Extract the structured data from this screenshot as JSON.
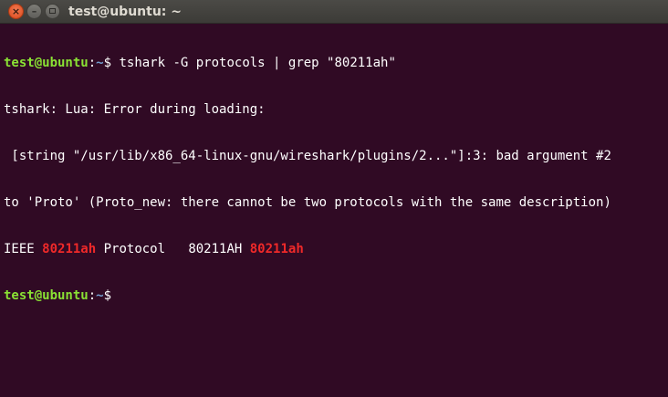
{
  "window": {
    "title": "test@ubuntu: ~",
    "buttons": {
      "close_glyph": "×",
      "minimize_glyph": "–"
    }
  },
  "terminal": {
    "colors": {
      "background": "#300a24",
      "foreground": "#ffffff",
      "prompt_user": "#8ae234",
      "prompt_path": "#729fcf",
      "match": "#ef2929"
    },
    "prompt": {
      "user_host": "test@ubuntu",
      "colon": ":",
      "path": "~",
      "dollar": "$"
    },
    "command": " tshark -G protocols | grep \"80211ah\"",
    "output": {
      "line1": "tshark: Lua: Error during loading:",
      "line2": " [string \"/usr/lib/x86_64-linux-gnu/wireshark/plugins/2...\"]:3: bad argument #2",
      "line3": "to 'Proto' (Proto_new: there cannot be two protocols with the same description)",
      "result": {
        "prefix": "IEEE ",
        "match1": "80211ah",
        "middle": " Protocol   80211AH ",
        "match2": "80211ah"
      }
    }
  }
}
